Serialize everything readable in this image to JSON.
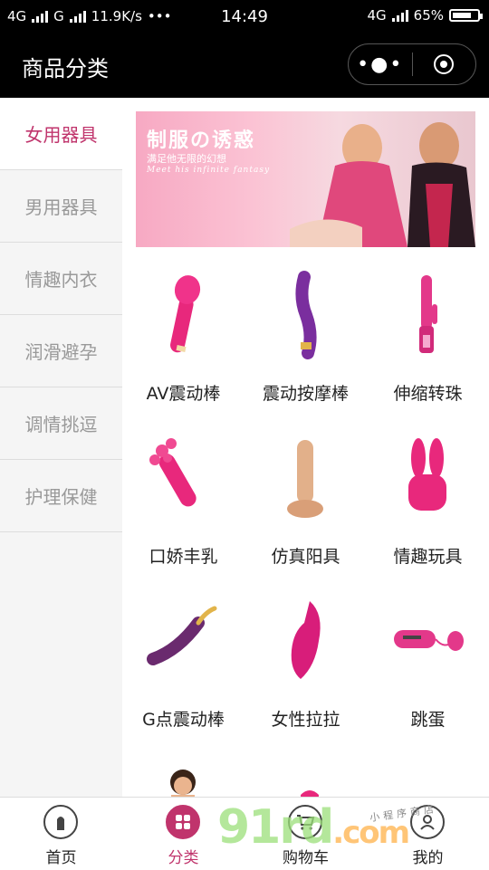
{
  "status": {
    "network_left": "4G",
    "network_mid": "G",
    "speed": "11.9K/s",
    "dots": "•••",
    "time": "14:49",
    "network_right": "4G",
    "battery": "65%"
  },
  "navbar": {
    "title": "商品分类",
    "more_icon": "more-dots-icon",
    "close_icon": "target-circle-icon"
  },
  "sidebar": {
    "items": [
      {
        "label": "女用器具",
        "active": true
      },
      {
        "label": "男用器具",
        "active": false
      },
      {
        "label": "情趣内衣",
        "active": false
      },
      {
        "label": "润滑避孕",
        "active": false
      },
      {
        "label": "调情挑逗",
        "active": false
      },
      {
        "label": "护理保健",
        "active": false
      }
    ]
  },
  "banner": {
    "title": "制服の诱惑",
    "subtitle": "满足他无限的幻想",
    "subtitle_en": "Meet his infinite fantasy"
  },
  "products": [
    {
      "label": "AV震动棒",
      "icon": "wand-massager-icon",
      "color": "#e8287c"
    },
    {
      "label": "震动按摩棒",
      "icon": "curved-vibrator-icon",
      "color": "#7a2e9e"
    },
    {
      "label": "伸缩转珠",
      "icon": "rabbit-vibrator-icon",
      "color": "#e3388a"
    },
    {
      "label": "口娇丰乳",
      "icon": "bristle-toy-icon",
      "color": "#e8287c"
    },
    {
      "label": "仿真阳具",
      "icon": "realistic-toy-icon",
      "color": "#e2b08a"
    },
    {
      "label": "情趣玩具",
      "icon": "bunny-ears-toy-icon",
      "color": "#e8287c"
    },
    {
      "label": "G点震动棒",
      "icon": "g-spot-wand-icon",
      "color": "#6a2a6e"
    },
    {
      "label": "女性拉拉",
      "icon": "dual-toy-icon",
      "color": "#d81d7a"
    },
    {
      "label": "跳蛋",
      "icon": "egg-vibrator-icon",
      "color": "#e3388a"
    }
  ],
  "tabbar": {
    "items": [
      {
        "label": "首页",
        "icon": "home-icon",
        "active": false
      },
      {
        "label": "分类",
        "icon": "category-grid-icon",
        "active": true
      },
      {
        "label": "购物车",
        "icon": "cart-icon",
        "active": false
      },
      {
        "label": "我的",
        "icon": "user-icon",
        "active": false
      }
    ]
  },
  "watermark": {
    "main": "91rd",
    "suffix": ".com",
    "note": "小程序商店"
  },
  "colors": {
    "accent": "#c0346c",
    "bar": "#000000"
  }
}
